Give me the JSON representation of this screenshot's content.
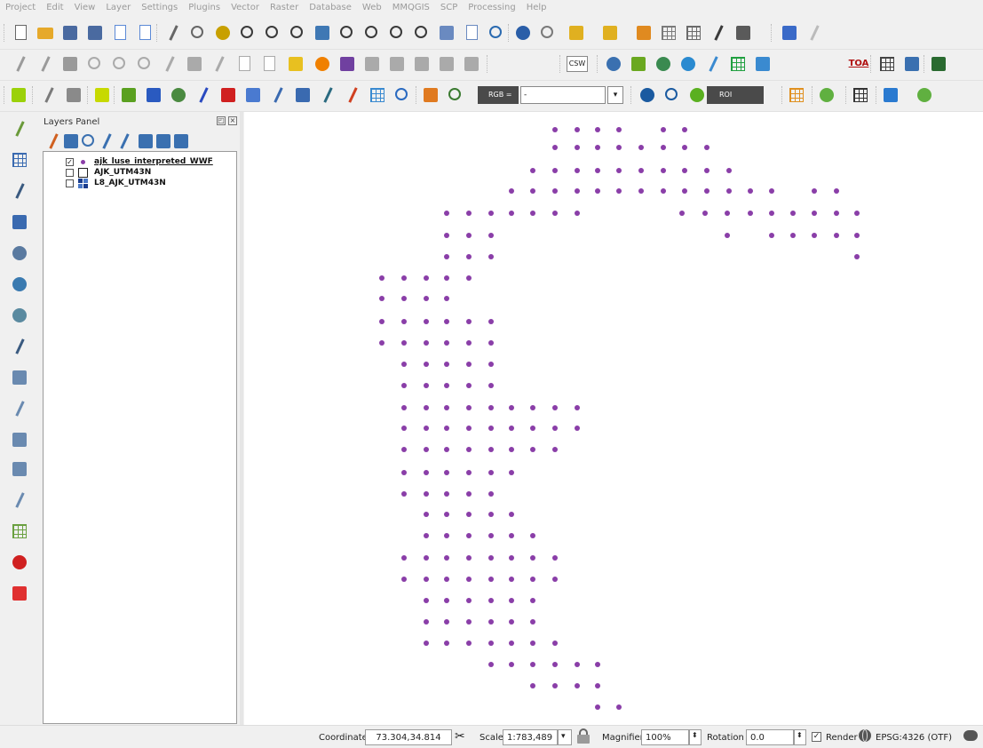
{
  "menu": [
    "Project",
    "Edit",
    "View",
    "Layer",
    "Settings",
    "Plugins",
    "Vector",
    "Raster",
    "Database",
    "Web",
    "MMQGIS",
    "SCP",
    "Processing",
    "Help"
  ],
  "toolbar3": {
    "rgb_label": "RGB =",
    "rgb_value": "-",
    "roi_label": "ROI"
  },
  "toolbar2": {
    "csw_label": "CSW",
    "toa_label": "TOA"
  },
  "layers_panel": {
    "title": "Layers Panel",
    "layers": [
      {
        "name": "ajk_luse_interpreted_WWF",
        "checked": true,
        "selected": true
      },
      {
        "name": "AJK_UTM43N",
        "checked": false,
        "selected": false
      },
      {
        "name": "L8_AJK_UTM43N",
        "checked": false,
        "selected": false
      }
    ]
  },
  "map": {
    "point_color": "#8a3ea8"
  },
  "status": {
    "coordinate_label": "Coordinate",
    "coordinate_value": "73.304,34.814",
    "scale_label": "Scale",
    "scale_value": "1:783,489",
    "magnifier_label": "Magnifier",
    "magnifier_value": "100%",
    "rotation_label": "Rotation",
    "rotation_value": "0.0",
    "render_label": "Render",
    "render_checked": true,
    "crs_label": "EPSG:4326 (OTF)"
  }
}
